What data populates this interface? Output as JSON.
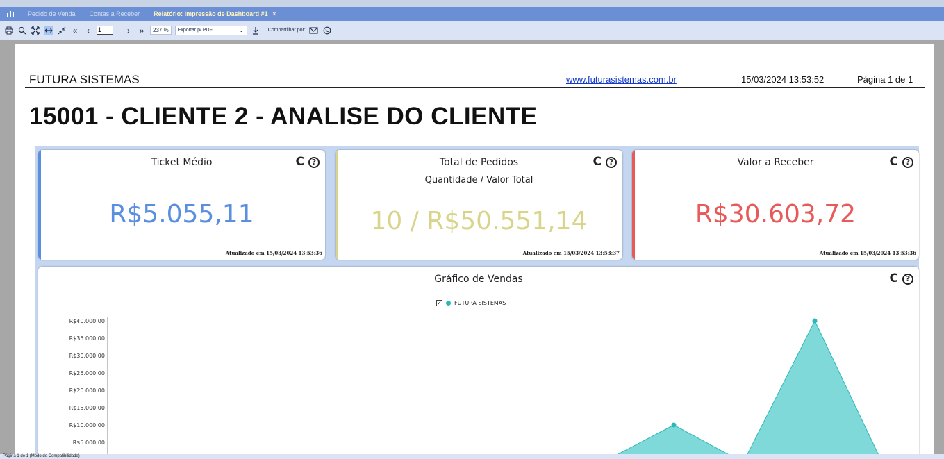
{
  "tabs": [
    {
      "label": "Pedido de Venda"
    },
    {
      "label": "Contas a Receber"
    },
    {
      "label": "Relatório: Impressão de Dashboard #1",
      "close": "×"
    }
  ],
  "toolbar": {
    "page_value": "1",
    "zoom": "237 %",
    "export_option": "Exportar p/ PDF",
    "share_label": "Compartilhar por:"
  },
  "report": {
    "company": "FUTURA SISTEMAS",
    "website": "www.futurasistemas.com.br",
    "datetime": "15/03/2024 13:53:52",
    "page_label": "Página 1 de 1",
    "title": "15001 - CLIENTE 2 - ANALISE DO CLIENTE"
  },
  "cards": {
    "ticket": {
      "title": "Ticket Médio",
      "value": "R$5.055,11",
      "updated": "Atualizado em 15/03/2024 13:53:36",
      "accent": "#5a8fdf"
    },
    "pedidos": {
      "title": "Total de Pedidos",
      "subtitle": "Quantidade / Valor Total",
      "value": "10 / R$50.551,14",
      "updated": "Atualizado em 15/03/2024 13:53:37",
      "accent": "#d8d58a"
    },
    "receber": {
      "title": "Valor a Receber",
      "value": "R$30.603,72",
      "updated": "Atualizado em 15/03/2024 13:53:36",
      "accent": "#e85a5a"
    }
  },
  "chart_card": {
    "title": "Gráfico de Vendas"
  },
  "chart_data": {
    "type": "area",
    "title": "Gráfico de Vendas",
    "series": [
      {
        "name": "FUTURA SISTEMAS",
        "color": "#29b8b8",
        "fill": "#7fd9d9"
      }
    ],
    "y_ticks": [
      "R$40.000,00",
      "R$35.000,00",
      "R$30.000,00",
      "R$25.000,00",
      "R$20.000,00",
      "R$15.000,00",
      "R$10.000,00",
      "R$5.000,00"
    ],
    "ylim": [
      0,
      40000
    ],
    "visible_points": [
      {
        "y": 0
      },
      {
        "y": 10000
      },
      {
        "y": 0
      },
      {
        "y": 40000
      },
      {
        "y": 0
      }
    ]
  },
  "status": "Página 1 de 1 (Modo de Compatibilidade)"
}
